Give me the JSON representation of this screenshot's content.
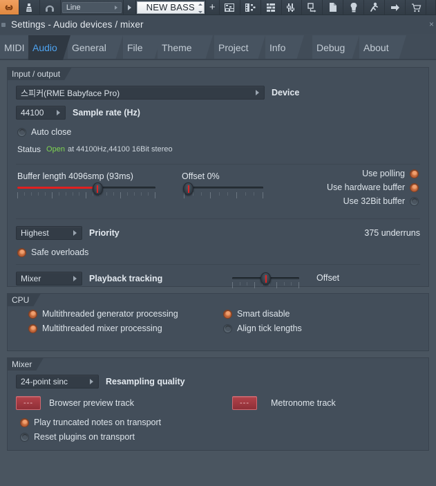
{
  "toolbar": {
    "link_icon": "link-chain-icon",
    "metronome_icon": "metronome-icon",
    "headphones_icon": "headphones-icon",
    "pattern_select_value": "Line",
    "pattern_name_value": "NEW BASS",
    "add_label": "+",
    "icons": [
      "playlist-icon",
      "step-sequencer-icon",
      "piano-roll-icon",
      "mixer-icon",
      "browser-icon",
      "save-copy-icon",
      "plugin-picker-icon",
      "project-bouncer-icon",
      "click-drag-icon",
      "shop-cart-icon"
    ]
  },
  "window": {
    "title": "Settings - Audio devices / mixer",
    "close_label": "×"
  },
  "tabs": [
    {
      "label": "MIDI",
      "selected": false
    },
    {
      "label": "Audio",
      "selected": true
    },
    {
      "label": "General",
      "selected": false
    },
    {
      "label": "File",
      "selected": false
    },
    {
      "label": "Theme",
      "selected": false
    },
    {
      "label": "Project",
      "selected": false
    },
    {
      "label": "Info",
      "selected": false
    },
    {
      "label": "Debug",
      "selected": false
    },
    {
      "label": "About",
      "selected": false
    }
  ],
  "input_output": {
    "section_title": "Input / output",
    "device_value": "스피커(RME Babyface Pro)",
    "device_label": "Device",
    "sample_rate_value": "44100",
    "sample_rate_label": "Sample rate (Hz)",
    "auto_close_label": "Auto close",
    "auto_close_checked": false,
    "status_label": "Status",
    "status_state": "Open",
    "status_detail": "at 44100Hz,44100 16Bit stereo",
    "status_color": "#7fd452",
    "buffer_caption": "Buffer length 4096smp (93ms)",
    "buffer_percent": 58,
    "offset_caption": "Offset 0%",
    "offset_percent": 6,
    "use_polling_label": "Use polling",
    "use_polling_checked": true,
    "use_hardware_buffer_label": "Use hardware buffer",
    "use_hardware_buffer_checked": true,
    "use_32bit_buffer_label": "Use 32Bit buffer",
    "use_32bit_buffer_checked": false,
    "priority_value": "Highest",
    "priority_label": "Priority",
    "underruns_text": "375 underruns",
    "safe_overloads_label": "Safe overloads",
    "safe_overloads_checked": true,
    "playback_tracking_value": "Mixer",
    "playback_tracking_label": "Playback tracking",
    "tracking_offset_label": "Offset",
    "tracking_offset_percent": 50
  },
  "cpu": {
    "section_title": "CPU",
    "options_left": [
      {
        "label": "Multithreaded generator processing",
        "checked": true
      },
      {
        "label": "Multithreaded mixer processing",
        "checked": true
      }
    ],
    "options_right": [
      {
        "label": "Smart disable",
        "checked": true
      },
      {
        "label": "Align tick lengths",
        "checked": false
      }
    ]
  },
  "mixer": {
    "section_title": "Mixer",
    "resampling_value": "24-point sinc",
    "resampling_label": "Resampling quality",
    "browser_preview_btn": "---",
    "browser_preview_label": "Browser preview track",
    "metronome_btn": "---",
    "metronome_label": "Metronome track",
    "options": [
      {
        "label": "Play truncated notes on transport",
        "checked": true
      },
      {
        "label": "Reset plugins on transport",
        "checked": false
      }
    ]
  },
  "colors": {
    "accent_blue": "#4ea3f0",
    "radio_on": "#f2a070",
    "slider_red": "#e02020",
    "panel_bg": "#434e5a",
    "window_bg": "#4a5560"
  }
}
